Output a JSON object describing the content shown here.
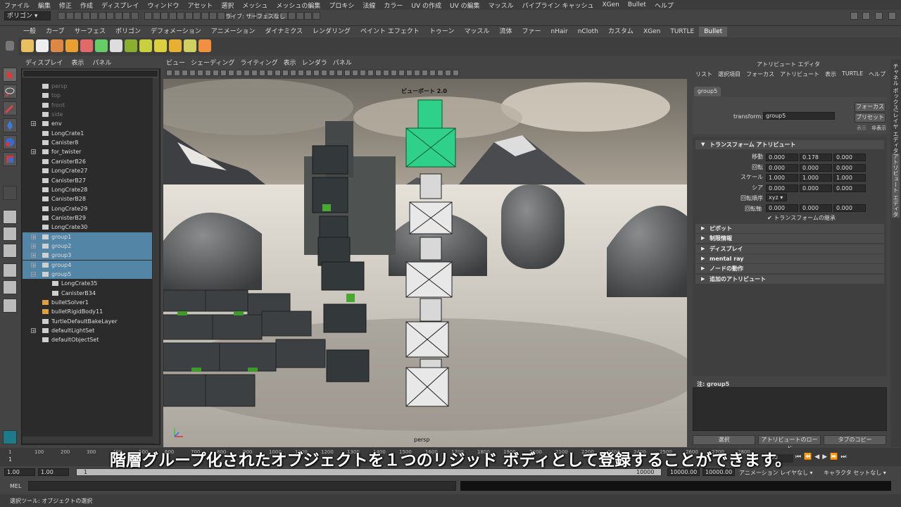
{
  "menubar": [
    "ファイル",
    "編集",
    "修正",
    "作成",
    "ディスプレイ",
    "ウィンドウ",
    "アセット",
    "選択",
    "メッシュ",
    "メッシュの編集",
    "プロキシ",
    "法線",
    "カラー",
    "UV の作成",
    "UV の編集",
    "マッスル",
    "パイプライン キャッシュ",
    "XGen",
    "Bullet",
    "ヘルプ"
  ],
  "status": {
    "mode": "ポリゴン",
    "live_label": "ライブ: サーフェスなし"
  },
  "shelf_tabs": [
    "一般",
    "カーブ",
    "サーフェス",
    "ポリゴン",
    "デフォメーション",
    "アニメーション",
    "ダイナミクス",
    "レンダリング",
    "ペイント エフェクト",
    "トゥーン",
    "マッスル",
    "流体",
    "ファー",
    "nHair",
    "nCloth",
    "カスタム",
    "XGen",
    "TURTLE",
    "Bullet"
  ],
  "shelf_active": "Bullet",
  "outliner": {
    "menu": [
      "ディスプレイ",
      "表示",
      "パネル"
    ],
    "items": [
      {
        "label": "persp",
        "dim": true
      },
      {
        "label": "top",
        "dim": true
      },
      {
        "label": "front",
        "dim": true
      },
      {
        "label": "side",
        "dim": true
      },
      {
        "label": "env"
      },
      {
        "label": "LongCrate1"
      },
      {
        "label": "Canister8"
      },
      {
        "label": "for_twister"
      },
      {
        "label": "CanisterB26"
      },
      {
        "label": "LongCrate27"
      },
      {
        "label": "CanisterB27"
      },
      {
        "label": "LongCrate28"
      },
      {
        "label": "CanisterB28"
      },
      {
        "label": "LongCrate29"
      },
      {
        "label": "CanisterB29"
      },
      {
        "label": "LongCrate30"
      },
      {
        "label": "group1",
        "sel": true
      },
      {
        "label": "group2",
        "sel": true
      },
      {
        "label": "group3",
        "sel": true
      },
      {
        "label": "group4",
        "sel": true
      },
      {
        "label": "group5",
        "sel": true
      },
      {
        "label": "LongCrate35"
      },
      {
        "label": "CanisterB34"
      },
      {
        "label": "bulletSolver1"
      },
      {
        "label": "bulletRigidBody11"
      },
      {
        "label": "TurtleDefaultBakeLayer"
      },
      {
        "label": "defaultLightSet"
      },
      {
        "label": "defaultObjectSet"
      }
    ]
  },
  "viewport": {
    "menu": [
      "ビュー",
      "シェーディング",
      "ライティング",
      "表示",
      "レンダラ",
      "パネル"
    ],
    "hud_title": "ビューポート 2.0",
    "camera": "persp"
  },
  "attribute_editor": {
    "title": "アトリビュート エディタ",
    "menu": [
      "リスト",
      "選択項目",
      "フォーカス",
      "アトリビュート",
      "表示",
      "TURTLE",
      "ヘルプ"
    ],
    "tab": "group5",
    "transform_label": "transform:",
    "transform_value": "group5",
    "btn_focus": "フォーカス",
    "btn_preset": "プリセット",
    "show_label": "表示",
    "hide_label": "非表示",
    "section": "トランスフォーム アトリビュート",
    "rows": [
      {
        "label": "移動",
        "values": [
          "0.000",
          "0.178",
          "0.000"
        ]
      },
      {
        "label": "回転",
        "values": [
          "0.000",
          "0.000",
          "0.000"
        ]
      },
      {
        "label": "スケール",
        "values": [
          "1.000",
          "1.000",
          "1.000"
        ]
      },
      {
        "label": "シア",
        "values": [
          "0.000",
          "0.000",
          "0.000"
        ]
      }
    ],
    "rotate_order_label": "回転順序",
    "rotate_order": "xyz",
    "rotate_axis_label": "回転軸",
    "rotate_axis": [
      "0.000",
      "0.000",
      "0.000"
    ],
    "inherit_label": "トランスフォームの継承",
    "frames": [
      "ピボット",
      "制限情報",
      "ディスプレイ",
      "mental ray",
      "ノードの動作",
      "追加のアトリビュート"
    ],
    "notes_label": "注: group5",
    "bottom_buttons": [
      "選択",
      "アトリビュートのロード",
      "タブのコピー"
    ],
    "side_tabs": [
      "チャネル ボックス/レイヤ エディタ",
      "アトリビュート エディタ"
    ]
  },
  "timeline": {
    "ticks": [
      "1",
      "100",
      "200",
      "300",
      "400",
      "500",
      "600",
      "700",
      "800",
      "900",
      "1000",
      "1100",
      "1200",
      "1300",
      "1400",
      "1500",
      "1600",
      "1700",
      "1800",
      "1900",
      "2000",
      "2100",
      "2200",
      "2300",
      "2400",
      "2500",
      "2600",
      "2700",
      "2800"
    ],
    "current": "1.00",
    "start": "1",
    "range_start": "1.00",
    "range_start2": "1.00",
    "range_mark": "1",
    "end": "10000",
    "end2": "10000.00",
    "end3": "10000.00",
    "anim_layer": "アニメーション レイヤなし",
    "char_set": "キャラクタ セットなし"
  },
  "cmdline_label": "MEL",
  "helpline": "選択ツール: オブジェクトの選択",
  "subtitle": "階層グループ化されたオブジェクトを１つのリジッド ボディとして登録することができます。"
}
